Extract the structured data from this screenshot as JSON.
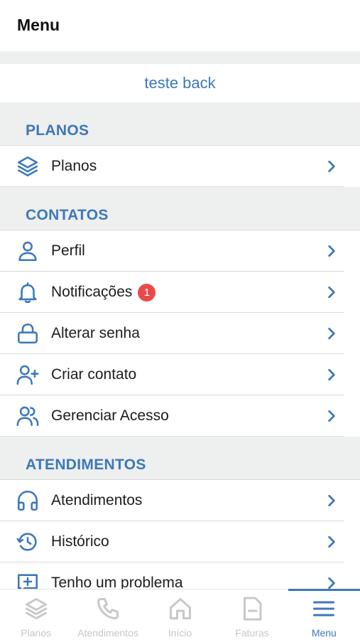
{
  "header": {
    "title": "Menu"
  },
  "account": {
    "name": "teste back"
  },
  "sections": {
    "planos": {
      "title": "PLANOS",
      "items": [
        {
          "label": "Planos",
          "icon": "layers-icon"
        }
      ]
    },
    "contatos": {
      "title": "CONTATOS",
      "items": [
        {
          "label": "Perfil",
          "icon": "user-icon"
        },
        {
          "label": "Notificações",
          "icon": "bell-icon",
          "badge": "1"
        },
        {
          "label": "Alterar senha",
          "icon": "lock-icon"
        },
        {
          "label": "Criar contato",
          "icon": "user-plus-icon"
        },
        {
          "label": "Gerenciar Acesso",
          "icon": "users-icon"
        }
      ]
    },
    "atendimentos": {
      "title": "ATENDIMENTOS",
      "items": [
        {
          "label": "Atendimentos",
          "icon": "headphones-icon"
        },
        {
          "label": "Histórico",
          "icon": "history-icon"
        },
        {
          "label": "Tenho um problema",
          "icon": "message-plus-icon"
        }
      ]
    }
  },
  "tabbar": {
    "tabs": [
      {
        "label": "Planos",
        "icon": "layers-icon"
      },
      {
        "label": "Atendimentos",
        "icon": "phone-icon"
      },
      {
        "label": "Início",
        "icon": "home-icon"
      },
      {
        "label": "Faturas",
        "icon": "document-icon"
      },
      {
        "label": "Menu",
        "icon": "menu-icon",
        "active": true
      }
    ]
  },
  "colors": {
    "accent": "#3d78b9",
    "badge": "#e84a4a",
    "background": "#eeefef"
  }
}
